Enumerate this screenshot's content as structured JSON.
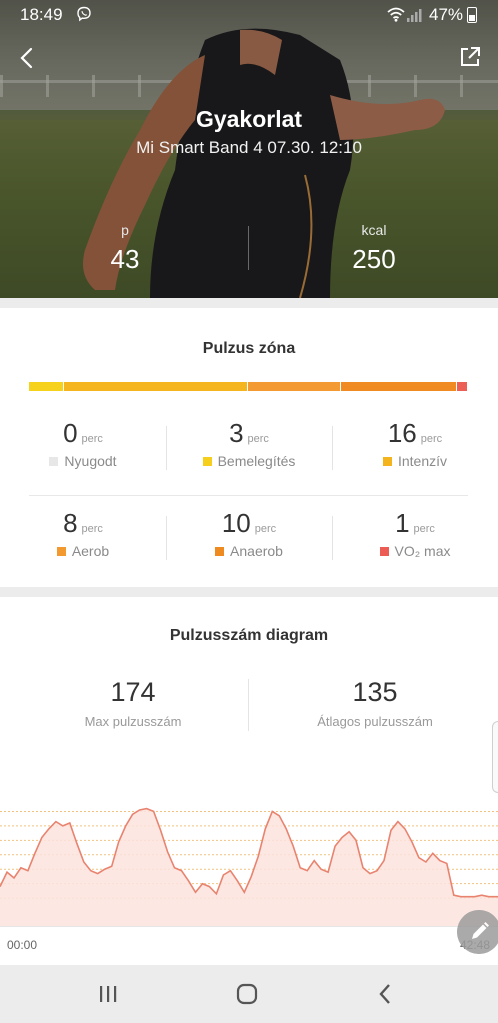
{
  "status_bar": {
    "time": "18:49",
    "battery_percent": "47%"
  },
  "header": {
    "title": "Gyakorlat",
    "subtitle": "Mi Smart Band 4 07.30. 12:10",
    "stats": [
      {
        "label": "p",
        "value": "43"
      },
      {
        "label": "kcal",
        "value": "250"
      }
    ]
  },
  "heart_zone": {
    "title": "Pulzus zóna",
    "bar_segments": [
      {
        "color": "#f7d21c",
        "fraction": 0.08
      },
      {
        "color": "#f5b51e",
        "fraction": 0.42
      },
      {
        "color": "#f39a32",
        "fraction": 0.21
      },
      {
        "color": "#f08a22",
        "fraction": 0.265
      },
      {
        "color": "#ec5f57",
        "fraction": 0.025
      }
    ],
    "zones": [
      {
        "value": "0",
        "unit": "perc",
        "name": "Nyugodt",
        "color": "#e7e7e7"
      },
      {
        "value": "3",
        "unit": "perc",
        "name": "Bemelegítés",
        "color": "#f6cf1c"
      },
      {
        "value": "16",
        "unit": "perc",
        "name": "Intenzív",
        "color": "#f4b41e"
      },
      {
        "value": "8",
        "unit": "perc",
        "name": "Aerob",
        "color": "#f29a2f"
      },
      {
        "value": "10",
        "unit": "perc",
        "name": "Anaerob",
        "color": "#ef8a20"
      },
      {
        "value": "1",
        "unit": "perc",
        "name": "VO₂ max",
        "color": "#ec5c55"
      }
    ]
  },
  "pulse_chart": {
    "title": "Pulzusszám diagram",
    "stats": [
      {
        "value": "174",
        "label": "Max pulzusszám"
      },
      {
        "value": "135",
        "label": "Átlagos pulzusszám"
      }
    ],
    "start_label": "00:00",
    "end_label": "42:48",
    "line_color": "#e8836f",
    "fill_color": "#fbe3dd",
    "guide_color": "#f2c27f"
  },
  "icons": {
    "back": "back-arrow-icon",
    "share": "share-icon",
    "edit": "pencil-icon",
    "nav_recent": "recent-apps-icon",
    "nav_home": "home-icon",
    "nav_back": "nav-back-icon"
  },
  "chart_data": {
    "type": "area",
    "title": "Pulzusszám diagram",
    "xlabel": "",
    "ylabel": "",
    "x_range": [
      "00:00",
      "42:48"
    ],
    "ylim": [
      90,
      180
    ],
    "grid_lines": [
      110,
      120,
      130,
      140,
      150,
      160,
      170
    ],
    "series": [
      {
        "x_minutes": [
          0,
          0.6,
          1.2,
          1.8,
          2.4,
          3,
          3.6,
          4.2,
          4.8,
          5.4,
          6,
          6.6,
          7.2,
          7.8,
          8.4,
          9,
          9.6,
          10.2,
          10.8,
          11.4,
          12,
          12.6,
          13.2,
          13.8,
          14.4,
          15,
          15.6,
          16.2,
          16.8,
          17.4,
          18,
          18.6,
          19.2,
          19.8,
          20.4,
          21,
          21.6,
          22.2,
          22.8,
          23.4,
          24,
          24.6,
          25.2,
          25.8,
          26.4,
          27,
          27.6,
          28.2,
          28.8,
          29.4,
          30,
          30.6,
          31.2,
          31.8,
          32.4,
          33,
          33.6,
          34.2,
          34.8,
          35.4,
          36,
          36.6,
          37.2,
          37.8,
          38.4,
          39,
          39.6,
          40.2,
          40.8,
          41.4,
          42,
          42.8
        ],
        "values": [
          118,
          128,
          124,
          131,
          129,
          141,
          152,
          158,
          163,
          160,
          162,
          148,
          135,
          129,
          127,
          130,
          132,
          149,
          160,
          168,
          171,
          172,
          170,
          157,
          142,
          131,
          129,
          122,
          114,
          120,
          118,
          113,
          126,
          129,
          122,
          114,
          125,
          139,
          158,
          170,
          167,
          158,
          146,
          131,
          129,
          136,
          130,
          128,
          146,
          152,
          156,
          150,
          131,
          127,
          129,
          136,
          157,
          163,
          158,
          149,
          138,
          135,
          141,
          136,
          134,
          112,
          111,
          111,
          111,
          112,
          111,
          111
        ]
      }
    ]
  }
}
